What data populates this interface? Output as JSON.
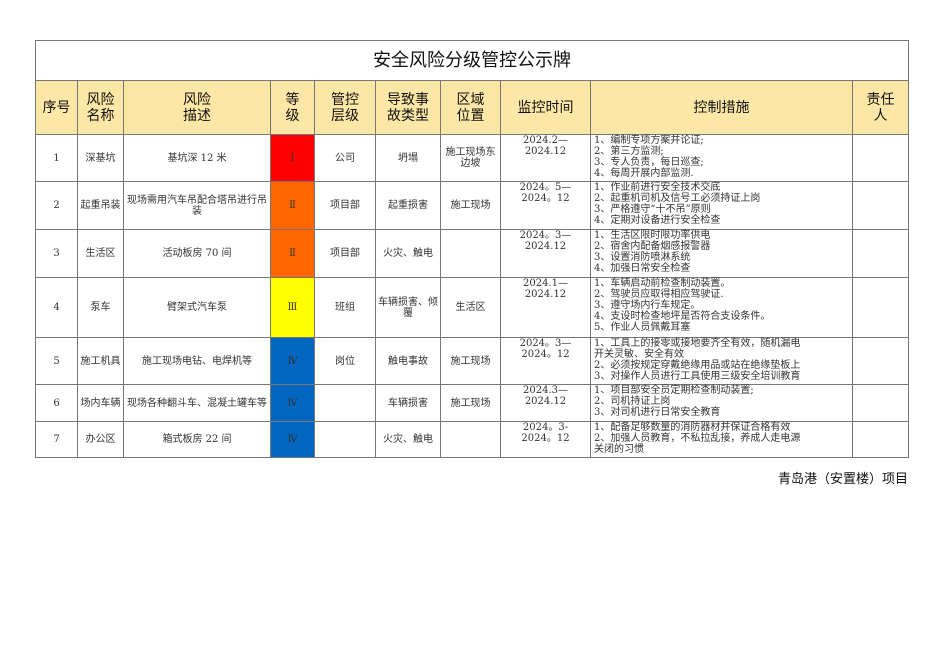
{
  "title": "安全风险分级管控公示牌",
  "headers": [
    "序号",
    "风险名称",
    "风险描述",
    "等级",
    "管控层级",
    "导致事故类型",
    "区域位置",
    "监控时间",
    "控制措施",
    "责任人"
  ],
  "header_lines": {
    "h1": [
      "风险",
      "名称"
    ],
    "h2": [
      "风险",
      "描述"
    ],
    "h3": [
      "等",
      "级"
    ],
    "h4": [
      "管控",
      "层级"
    ],
    "h5": [
      "导致事",
      "故类型"
    ],
    "h6": [
      "区域",
      "位置"
    ],
    "h9": [
      "责任",
      "人"
    ]
  },
  "level_colors": {
    "I": "#ff0000",
    "II": "#ff6600",
    "III": "#ffff00",
    "IV": "#0066bf"
  },
  "rows": [
    {
      "no": "1",
      "name": "深基坑",
      "desc": "基坑深 12 米",
      "level": "Ⅰ",
      "mgmt": "公司",
      "accident": "坍塌",
      "area": "施工现场东边坡",
      "time": [
        "2024.2—",
        "2024.12"
      ],
      "controls": [
        "1、编制专项方案并论证;",
        "2、第三方监测;",
        "3、专人负责，每日巡查;",
        "4、每周开展内部监测."
      ],
      "owner": ""
    },
    {
      "no": "2",
      "name": "起重吊装",
      "desc": "现场需用汽车吊配合塔吊进行吊装",
      "level": "Ⅱ",
      "mgmt": "项目部",
      "accident": "起重损害",
      "area": "施工现场",
      "time": [
        "2024。5—",
        "2024。12"
      ],
      "controls": [
        "1、作业前进行安全技术交底",
        "2、起重机司机及信号工必须持证上岗",
        "3、严格遵守“十不吊”原则",
        "4、定期对设备进行安全检查"
      ],
      "owner": ""
    },
    {
      "no": "3",
      "name": "生活区",
      "desc": "活动板房 70 间",
      "level": "Ⅱ",
      "mgmt": "项目部",
      "accident": "火灾、触电",
      "area": "",
      "time": [
        "2024。3—",
        "2024.12"
      ],
      "controls": [
        "1、生活区限时限功率供电",
        "2、宿舍内配备烟感报警器",
        "3、设置消防喷淋系统",
        "4、加强日常安全检查"
      ],
      "owner": ""
    },
    {
      "no": "4",
      "name": "泵车",
      "desc": "臂架式汽车泵",
      "level": "Ⅲ",
      "mgmt": "班组",
      "accident": "车辆损害、倾覆",
      "area": "生活区",
      "time": [
        "2024.1—",
        "2024.12"
      ],
      "controls": [
        "1、车辆启动前检查制动装置。",
        "2、驾驶员应取得相应驾驶证.",
        "3、遵守场内行车规定。",
        "4、支设时检查地坪是否符合支设条件。",
        "5、作业人员佩戴耳塞"
      ],
      "owner": ""
    },
    {
      "no": "5",
      "name": "施工机具",
      "desc": "施工现场电钻、电焊机等",
      "level": "Ⅳ",
      "mgmt": "岗位",
      "accident": "触电事故",
      "area": "施工现场",
      "time": [
        "2024。3—",
        "2024。12"
      ],
      "controls": [
        "1、工具上的接零或接地要齐全有效，随机漏电",
        "开关灵敏、安全有效",
        "2、必须按规定穿戴绝缘用品或站在绝缘垫板上",
        "3、对操作人员进行工具使用三级安全培训教育"
      ],
      "owner": ""
    },
    {
      "no": "6",
      "name": "场内车辆",
      "desc": "现场各种翻斗车、混凝土罐车等",
      "level": "Ⅳ",
      "mgmt": "",
      "accident": "车辆损害",
      "area": "施工现场",
      "time": [
        "2024.3—",
        "2024.12"
      ],
      "controls": [
        "1、项目部安全员定期检查制动装置;",
        "2、司机持证上岗",
        "3、对司机进行日常安全教育"
      ],
      "owner": ""
    },
    {
      "no": "7",
      "name": "办公区",
      "desc": "箱式板房 22 间",
      "level": "Ⅳ",
      "mgmt": "",
      "accident": "火灾、触电",
      "area": "",
      "time": [
        "2024。3-",
        "2024。12"
      ],
      "controls": [
        "1、配备足够数量的消防器材并保证合格有效",
        "2、加强人员教育，不私拉乱接，养成人走电源",
        "关闭的习惯"
      ],
      "owner": ""
    }
  ],
  "footer": "青岛港（安置楼）项目"
}
